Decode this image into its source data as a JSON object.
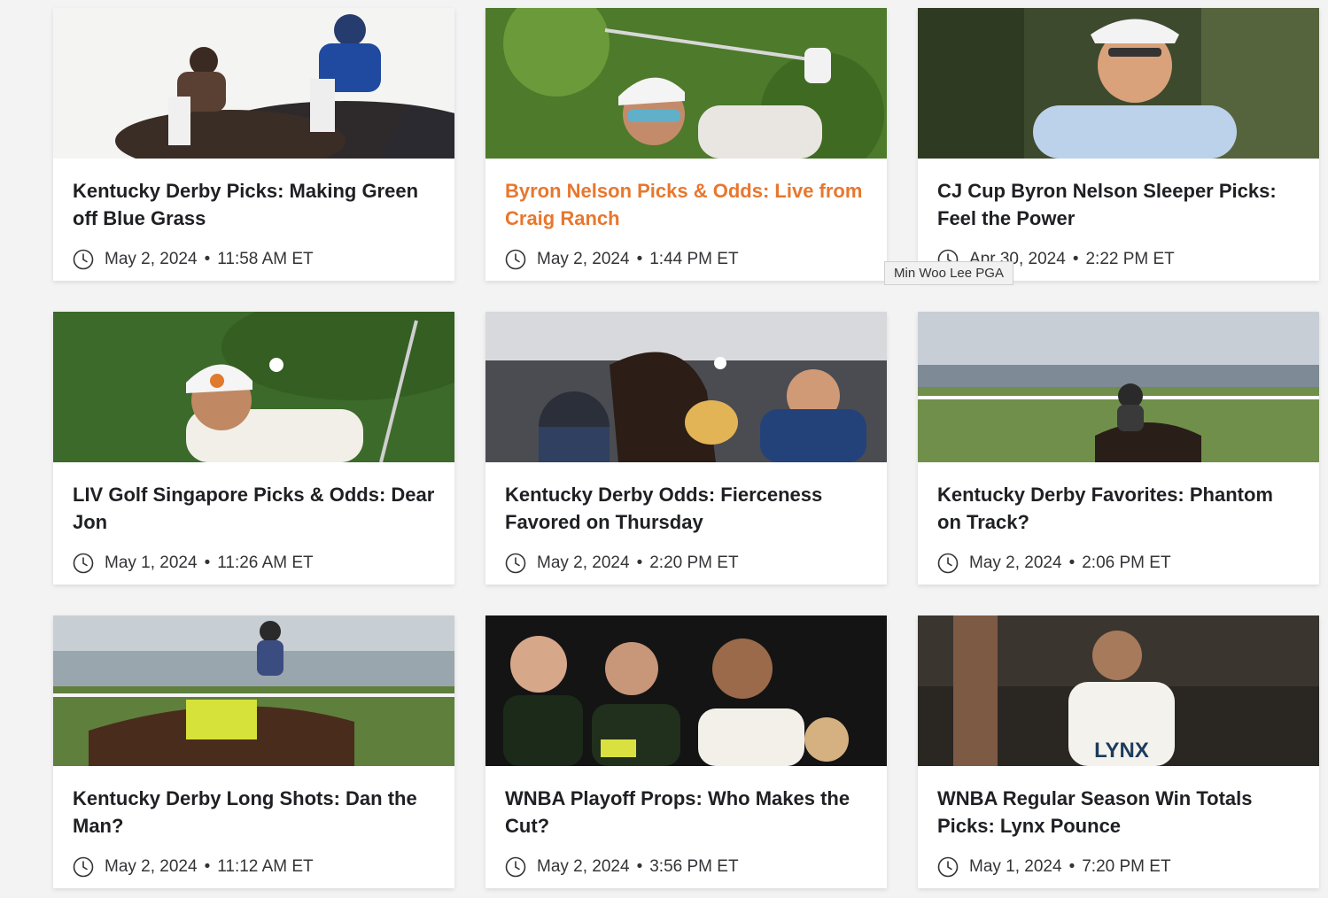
{
  "articles": [
    {
      "title": "Kentucky Derby Picks: Making Green off Blue Grass",
      "date": "May 2, 2024",
      "time": "11:58 AM ET",
      "image": "horse-racing-photo"
    },
    {
      "title": "Byron Nelson Picks & Odds: Live from Craig Ranch",
      "date": "May 2, 2024",
      "time": "1:44 PM ET",
      "image": "golfer-swing-photo"
    },
    {
      "title": "CJ Cup Byron Nelson Sleeper Picks: Feel the Power",
      "date": "Apr 30, 2024",
      "time": "2:22 PM ET",
      "image": "golfer-portrait-photo",
      "tooltip": "Min Woo Lee PGA"
    },
    {
      "title": "LIV Golf Singapore Picks & Odds: Dear Jon",
      "date": "May 1, 2024",
      "time": "11:26 AM ET",
      "image": "golfer-bunker-photo"
    },
    {
      "title": "Kentucky Derby Odds: Fierceness Favored on Thursday",
      "date": "May 2, 2024",
      "time": "2:20 PM ET",
      "image": "horse-groom-photo"
    },
    {
      "title": "Kentucky Derby Favorites: Phantom on Track?",
      "date": "May 2, 2024",
      "time": "2:06 PM ET",
      "image": "racetrack-photo"
    },
    {
      "title": "Kentucky Derby Long Shots: Dan the Man?",
      "date": "May 2, 2024",
      "time": "11:12 AM ET",
      "image": "horse-workout-photo"
    },
    {
      "title": "WNBA Playoff Props: Who Makes the Cut?",
      "date": "May 2, 2024",
      "time": "3:56 PM ET",
      "image": "wnba-players-photo"
    },
    {
      "title": "WNBA Regular Season Win Totals Picks: Lynx Pounce",
      "date": "May 1, 2024",
      "time": "7:20 PM ET",
      "image": "lynx-player-photo",
      "jersey": "LYNX"
    }
  ],
  "separator": "•",
  "colors": {
    "accent": "#e8772e",
    "title": "#1f2023",
    "meta": "#333437",
    "background": "#f3f3f4"
  }
}
